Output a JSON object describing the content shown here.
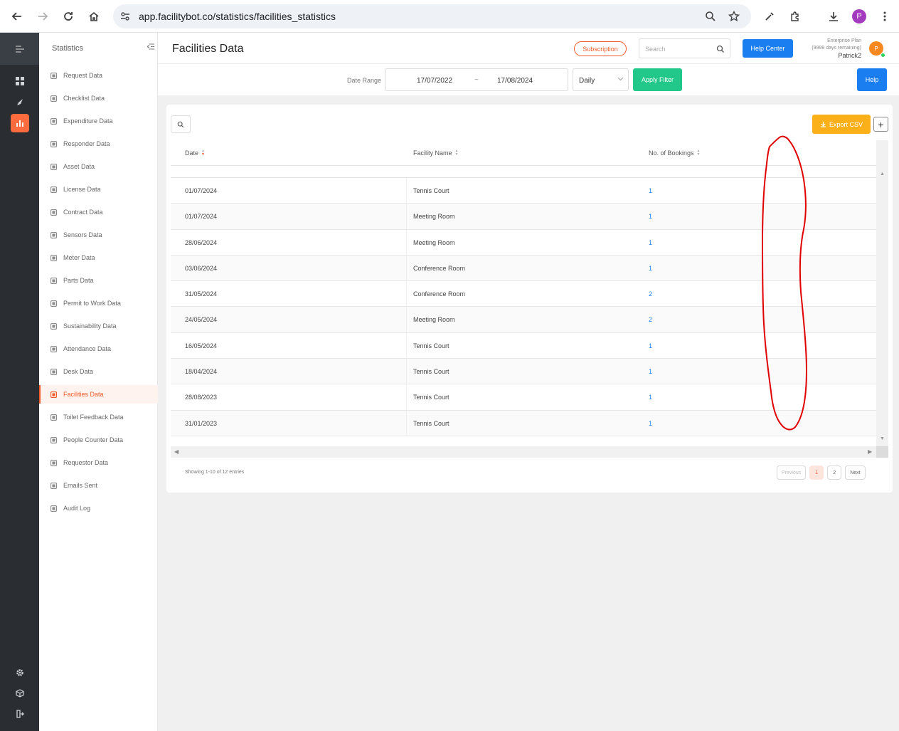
{
  "browser": {
    "url": "app.facilitybot.co/statistics/facilities_statistics",
    "profile_initial": "P"
  },
  "sidebar": {
    "title": "Statistics",
    "items": [
      {
        "label": "Request Data",
        "icon": "request-icon"
      },
      {
        "label": "Checklist Data",
        "icon": "checklist-icon"
      },
      {
        "label": "Expenditure Data",
        "icon": "expenditure-icon"
      },
      {
        "label": "Responder Data",
        "icon": "responder-icon"
      },
      {
        "label": "Asset Data",
        "icon": "asset-icon"
      },
      {
        "label": "License Data",
        "icon": "license-icon"
      },
      {
        "label": "Contract Data",
        "icon": "contract-icon"
      },
      {
        "label": "Sensors Data",
        "icon": "sensors-icon"
      },
      {
        "label": "Meter Data",
        "icon": "meter-icon"
      },
      {
        "label": "Parts Data",
        "icon": "parts-icon"
      },
      {
        "label": "Permit to Work Data",
        "icon": "permit-icon"
      },
      {
        "label": "Sustainability Data",
        "icon": "sustainability-icon"
      },
      {
        "label": "Attendance Data",
        "icon": "attendance-icon"
      },
      {
        "label": "Desk Data",
        "icon": "desk-icon"
      },
      {
        "label": "Facilities Data",
        "icon": "facilities-icon",
        "active": true
      },
      {
        "label": "Toilet Feedback Data",
        "icon": "toilet-feedback-icon"
      },
      {
        "label": "People Counter Data",
        "icon": "people-counter-icon"
      },
      {
        "label": "Requestor Data",
        "icon": "requestor-icon"
      },
      {
        "label": "Emails Sent",
        "icon": "email-icon"
      },
      {
        "label": "Audit Log",
        "icon": "audit-log-icon"
      }
    ]
  },
  "header": {
    "title": "Facilities Data",
    "subscription_label": "Subscription",
    "search_placeholder": "Search",
    "help_center_label": "Help Center",
    "plan_line1": "Enterprise Plan",
    "plan_line2": "(9999 days remaining)",
    "username": "Patrick2",
    "avatar_initial": "P"
  },
  "filter": {
    "label": "Date Range",
    "start_date": "17/07/2022",
    "separator": "~",
    "end_date": "17/08/2024",
    "period": "Daily",
    "apply_label": "Apply Filter",
    "help_label": "Help"
  },
  "table": {
    "export_label": "Export CSV",
    "plus_label": "+",
    "columns": [
      "Date",
      "Facility Name",
      "No. of Bookings"
    ],
    "rows": [
      [
        "01/07/2024",
        "Tennis Court",
        "1"
      ],
      [
        "01/07/2024",
        "Meeting Room",
        "1"
      ],
      [
        "28/06/2024",
        "Meeting Room",
        "1"
      ],
      [
        "03/06/2024",
        "Conference Room",
        "1"
      ],
      [
        "31/05/2024",
        "Conference Room",
        "2"
      ],
      [
        "24/05/2024",
        "Meeting Room",
        "2"
      ],
      [
        "16/05/2024",
        "Tennis Court",
        "1"
      ],
      [
        "18/04/2024",
        "Tennis Court",
        "1"
      ],
      [
        "28/08/2023",
        "Tennis Court",
        "1"
      ],
      [
        "31/01/2023",
        "Tennis Court",
        "1"
      ]
    ],
    "showing": "Showing 1-10 of 12 entries",
    "pagination": {
      "previous": "Previous",
      "pages": [
        "1",
        "2"
      ],
      "current": "1",
      "next": "Next"
    }
  },
  "colors": {
    "accent": "#f05a28",
    "primary": "#1a7ef0",
    "apply": "#22c889",
    "export": "#fbb019",
    "annotation": "#e00000"
  }
}
